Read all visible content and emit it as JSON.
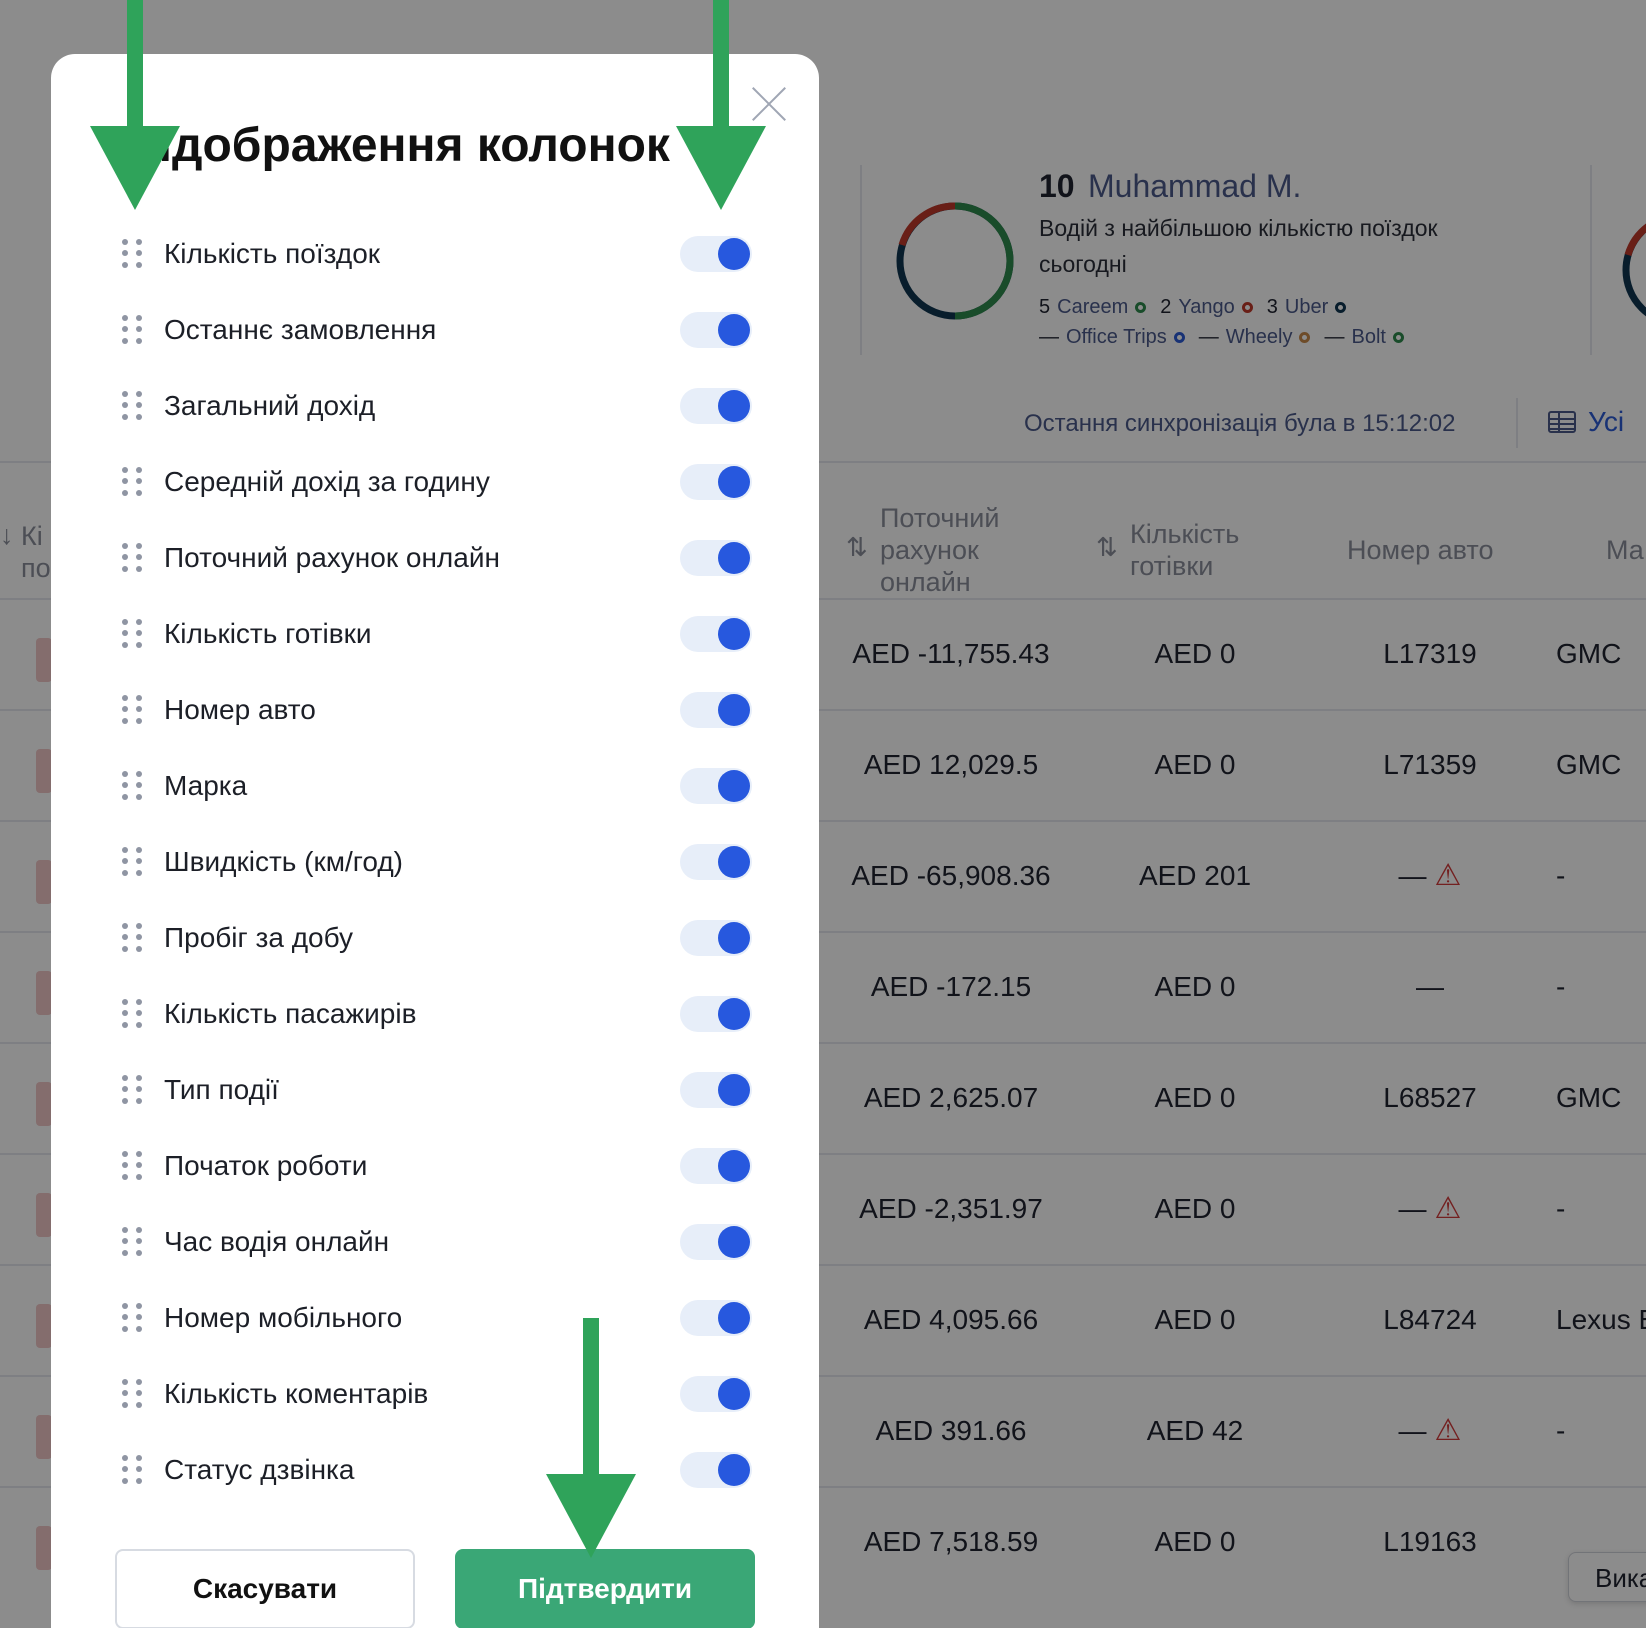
{
  "modal": {
    "title": "Відображення колонок",
    "columns": [
      {
        "label": "Кількість поїздок",
        "enabled": true
      },
      {
        "label": "Останнє замовлення",
        "enabled": true
      },
      {
        "label": "Загальний дохід",
        "enabled": true
      },
      {
        "label": "Середній дохід за годину",
        "enabled": true
      },
      {
        "label": "Поточний рахунок онлайн",
        "enabled": true
      },
      {
        "label": "Кількість готівки",
        "enabled": true
      },
      {
        "label": "Номер авто",
        "enabled": true
      },
      {
        "label": "Марка",
        "enabled": true
      },
      {
        "label": "Швидкість (км/год)",
        "enabled": true
      },
      {
        "label": "Пробіг за добу",
        "enabled": true
      },
      {
        "label": "Кількість пасажирів",
        "enabled": true
      },
      {
        "label": "Тип події",
        "enabled": true
      },
      {
        "label": "Початок роботи",
        "enabled": true
      },
      {
        "label": "Час водія онлайн",
        "enabled": true
      },
      {
        "label": "Номер мобільного",
        "enabled": true
      },
      {
        "label": "Кількість коментарів",
        "enabled": true
      },
      {
        "label": "Статус дзвінка",
        "enabled": true
      }
    ],
    "cancel_label": "Скасувати",
    "confirm_label": "Підтвердити"
  },
  "stats": {
    "count": "10",
    "driver_name": "Muhammad M.",
    "description": "Водій з найбільшою кількістю поїздок сьогодні",
    "legend_row1": [
      {
        "count": "5",
        "name": "Careem",
        "color": "#2e8b4e"
      },
      {
        "count": "2",
        "name": "Yango",
        "color": "#c0392b"
      },
      {
        "count": "3",
        "name": "Uber",
        "color": "#0f3550"
      }
    ],
    "legend_row2": [
      {
        "count": "—",
        "name": "Office Trips",
        "color": "#2d5bd6"
      },
      {
        "count": "—",
        "name": "Wheely",
        "color": "#c98a4b"
      },
      {
        "count": "—",
        "name": "Bolt",
        "color": "#2e8b4e"
      }
    ]
  },
  "sync_text": "Остання синхронізація була в 15:12:02",
  "all_label": "Усі",
  "table": {
    "headers": {
      "left_partial": "Кі\nпо",
      "online_balance": "Поточний рахунок онлайн",
      "cash": "Кількість готівки",
      "car_number": "Номер авто",
      "brand_partial": "Ма"
    },
    "rows": [
      {
        "balance": "AED -11,755.43",
        "cash": "AED 0",
        "car": "L17319",
        "warn": false,
        "brand": "GMC"
      },
      {
        "balance": "AED 12,029.5",
        "cash": "AED 0",
        "car": "L71359",
        "warn": false,
        "brand": "GMC"
      },
      {
        "balance": "AED -65,908.36",
        "cash": "AED 201",
        "car": "—",
        "warn": true,
        "brand": "-"
      },
      {
        "balance": "AED -172.15",
        "cash": "AED 0",
        "car": "—",
        "warn": false,
        "brand": "-"
      },
      {
        "balance": "AED 2,625.07",
        "cash": "AED 0",
        "car": "L68527",
        "warn": false,
        "brand": "GMC"
      },
      {
        "balance": "AED -2,351.97",
        "cash": "AED 0",
        "car": "—",
        "warn": true,
        "brand": "-"
      },
      {
        "balance": "AED 4,095.66",
        "cash": "AED 0",
        "car": "L84724",
        "warn": false,
        "brand": "Lexus E"
      },
      {
        "balance": "AED 391.66",
        "cash": "AED 42",
        "car": "—",
        "warn": true,
        "brand": "-"
      },
      {
        "balance": "AED 7,518.59",
        "cash": "AED 0",
        "car": "L19163",
        "warn": false,
        "brand": ""
      }
    ]
  },
  "floating_button": "Вика",
  "colors": {
    "toggle_on": "#2758de",
    "confirm": "#3aa776",
    "arrow": "#2fa35a",
    "overlay": "rgba(0,0,0,0.45)"
  }
}
